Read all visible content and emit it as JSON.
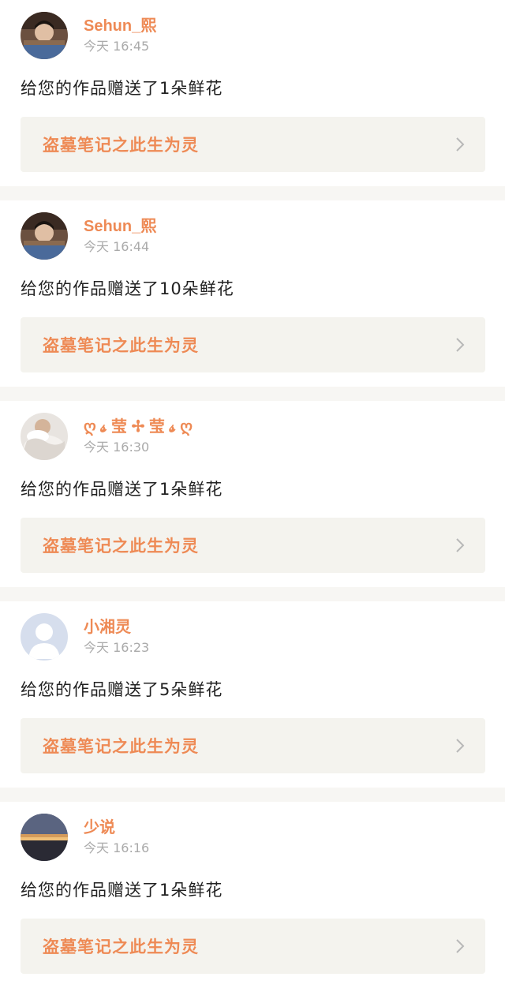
{
  "notifications": [
    {
      "username": "Sehun_熙",
      "time": "今天 16:45",
      "message": "给您的作品赠送了1朵鲜花",
      "work_title": "盗墓笔记之此生为灵",
      "avatar": "photo-avatar-boy"
    },
    {
      "username": "Sehun_熙",
      "time": "今天 16:44",
      "message": "给您的作品赠送了10朵鲜花",
      "work_title": "盗墓笔记之此生为灵",
      "avatar": "photo-avatar-boy"
    },
    {
      "username": "ღ 𝓼 莹 ✢ 莹 𝓼 ღ",
      "time": "今天 16:30",
      "message": "给您的作品赠送了1朵鲜花",
      "work_title": "盗墓笔记之此生为灵",
      "avatar": "photo-avatar-pet"
    },
    {
      "username": "小湘灵",
      "time": "今天 16:23",
      "message": "给您的作品赠送了5朵鲜花",
      "work_title": "盗墓笔记之此生为灵",
      "avatar": "default-avatar"
    },
    {
      "username": "少说",
      "time": "今天 16:16",
      "message": "给您的作品赠送了1朵鲜花",
      "work_title": "盗墓笔记之此生为灵",
      "avatar": "photo-avatar-sunset"
    }
  ],
  "icons": {
    "chevron": "chevron-right-icon"
  },
  "colors": {
    "accent": "#ee8a55",
    "text": "#222222",
    "muted": "#aaaaaa",
    "link_bg": "#f4f3ee",
    "page_bg": "#f7f6f3"
  }
}
